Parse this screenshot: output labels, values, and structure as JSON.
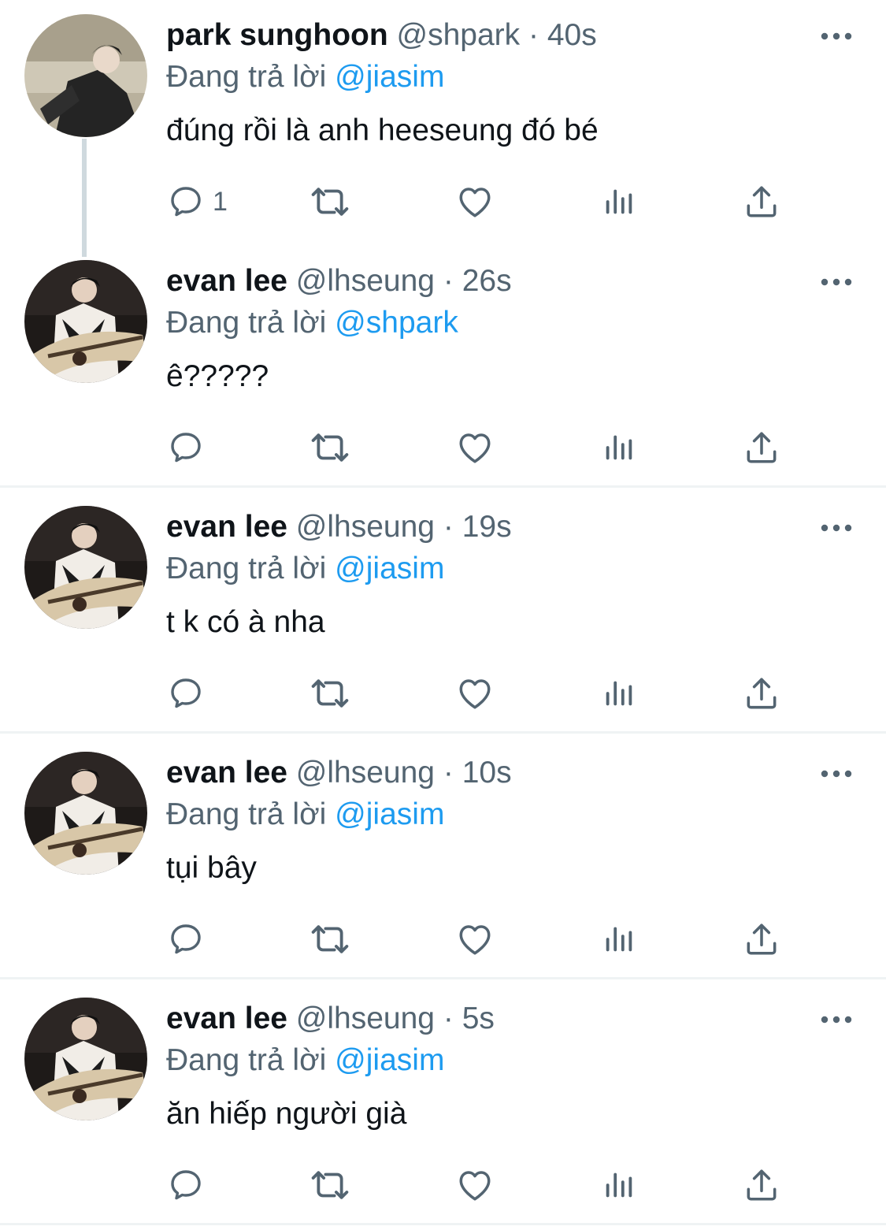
{
  "replying_prefix": "Đang trả lời",
  "tweets": [
    {
      "name": "park sunghoon",
      "handle": "@shpark",
      "separator": "·",
      "time": "40s",
      "reply_to": "@jiasim",
      "text": "đúng rồi là anh heeseung đó bé",
      "reply_count": "1"
    },
    {
      "name": "evan lee",
      "handle": "@lhseung",
      "separator": "·",
      "time": "26s",
      "reply_to": "@shpark",
      "text": "ê?????",
      "reply_count": ""
    },
    {
      "name": "evan lee",
      "handle": "@lhseung",
      "separator": "·",
      "time": "19s",
      "reply_to": "@jiasim",
      "text": "t k có à nha",
      "reply_count": ""
    },
    {
      "name": "evan lee",
      "handle": "@lhseung",
      "separator": "·",
      "time": "10s",
      "reply_to": "@jiasim",
      "text": "tụi bây",
      "reply_count": ""
    },
    {
      "name": "evan lee",
      "handle": "@lhseung",
      "separator": "·",
      "time": "5s",
      "reply_to": "@jiasim",
      "text": "ăn hiếp người già",
      "reply_count": ""
    }
  ],
  "icons": {
    "reply": "reply-icon",
    "retweet": "retweet-icon",
    "like": "like-icon",
    "views": "views-icon",
    "share": "share-icon",
    "more": "more-options-icon"
  },
  "colors": {
    "mention": "#1d9bf0",
    "secondary_text": "#536471",
    "primary_text": "#0f1419",
    "icon": "#536471",
    "divider": "#eff3f4",
    "thread_line": "#cfd9de"
  }
}
